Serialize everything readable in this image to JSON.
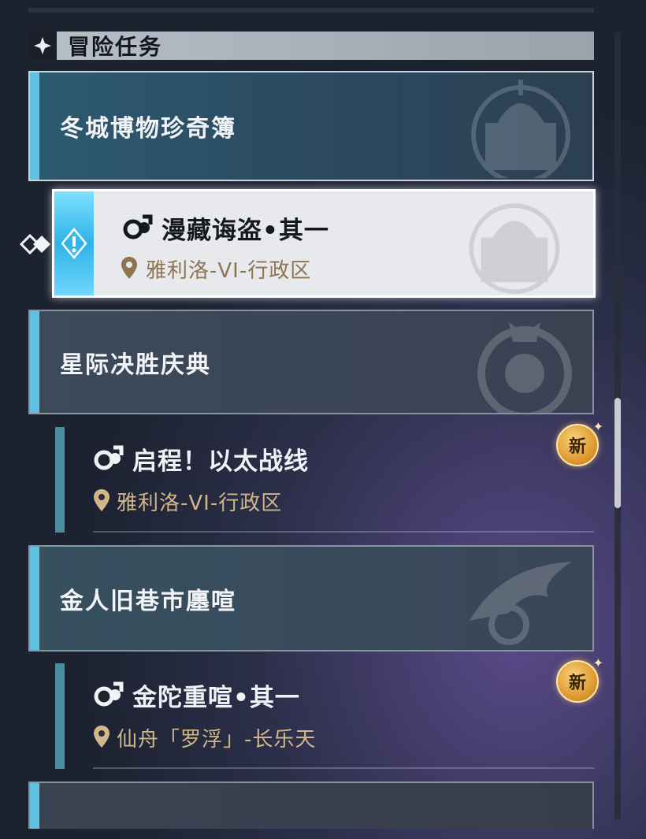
{
  "section": {
    "title": "冒险任务",
    "icon": "diamond-star-icon"
  },
  "groups": [
    {
      "title": "冬城博物珍奇簿"
    },
    {
      "title": "星际决胜庆典"
    },
    {
      "title": "金人旧巷市廛喧"
    },
    {
      "title": ""
    }
  ],
  "quests": [
    {
      "name": "漫藏诲盗•其一",
      "location": "雅利洛-VI-行政区",
      "selected": true,
      "new": false
    },
    {
      "name": "启程！以太战线",
      "location": "雅利洛-VI-行政区",
      "selected": false,
      "new": true
    },
    {
      "name": "金陀重喧•其一",
      "location": "仙舟「罗浮」-长乐天",
      "selected": false,
      "new": true
    }
  ],
  "badge": {
    "new_label": "新"
  },
  "colors": {
    "accent": "#5ec3e2",
    "location": "#d1b68a",
    "badge": "#d99228"
  }
}
